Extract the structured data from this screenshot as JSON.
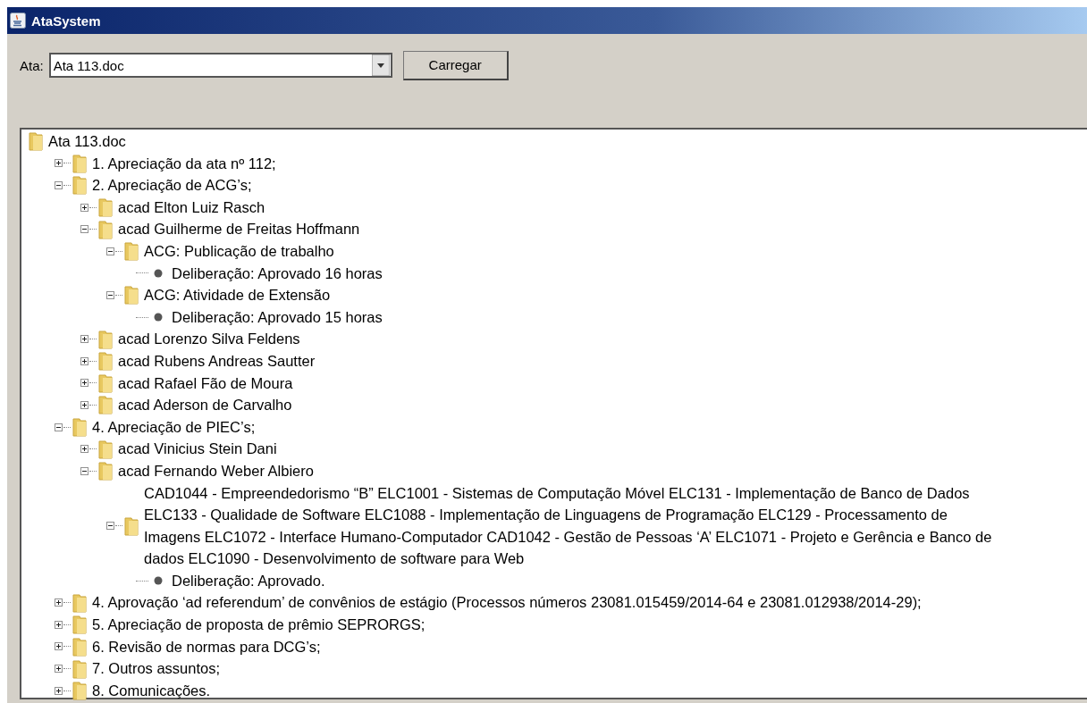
{
  "window": {
    "title": "AtaSystem"
  },
  "toolbar": {
    "label": "Ata:",
    "combo_value": "Ata 113.doc",
    "button": "Carregar"
  },
  "tree": {
    "label": "Ata 113.doc",
    "kind": "folder",
    "children": [
      {
        "label": "1. Apreciação da ata nº 112;",
        "kind": "folder",
        "expanded": false
      },
      {
        "label": "2. Apreciação de ACG’s;",
        "kind": "folder",
        "expanded": true,
        "children": [
          {
            "label": "acad Elton Luiz Rasch",
            "kind": "folder",
            "expanded": false
          },
          {
            "label": "acad Guilherme de Freitas Hoffmann",
            "kind": "folder",
            "expanded": true,
            "children": [
              {
                "label": "ACG: Publicação de trabalho",
                "kind": "folder",
                "expanded": true,
                "children": [
                  {
                    "label": "Deliberação: Aprovado 16 horas",
                    "kind": "leaf"
                  }
                ]
              },
              {
                "label": "ACG: Atividade de Extensão",
                "kind": "folder",
                "expanded": true,
                "children": [
                  {
                    "label": "Deliberação: Aprovado 15 horas",
                    "kind": "leaf"
                  }
                ]
              }
            ]
          },
          {
            "label": "acad Lorenzo Silva Feldens",
            "kind": "folder",
            "expanded": false
          },
          {
            "label": "acad Rubens Andreas Sautter",
            "kind": "folder",
            "expanded": false
          },
          {
            "label": "acad Rafael Fão de Moura",
            "kind": "folder",
            "expanded": false
          },
          {
            "label": "acad Aderson de Carvalho",
            "kind": "folder",
            "expanded": false
          }
        ]
      },
      {
        "label": "4. Apreciação de PIEC’s;",
        "kind": "folder",
        "expanded": true,
        "children": [
          {
            "label": "acad Vinicius Stein Dani",
            "kind": "folder",
            "expanded": false
          },
          {
            "label": "acad Fernando Weber Albiero",
            "kind": "folder",
            "expanded": true,
            "children": [
              {
                "label": "CAD1044 - Empreendedorismo “B” ELC1001 - Sistemas de Computação Móvel ELC131 - Implementação de Banco de Dados ELC133 - Qualidade de Software ELC1088 - Implementação de Linguagens de Programação ELC129 - Processamento de Imagens ELC1072 - Interface Humano-Computador CAD1042 - Gestão de Pessoas ‘A’ ELC1071 - Projeto e Gerência e Banco de dados ELC1090 - Desenvolvimento de software para Web",
                "kind": "folder",
                "expanded": true,
                "children": [
                  {
                    "label": "Deliberação: Aprovado.",
                    "kind": "leaf"
                  }
                ]
              }
            ]
          }
        ]
      },
      {
        "label": "4. Aprovação ‘ad referendum’ de convênios de estágio (Processos números 23081.015459/2014-64 e 23081.012938/2014-29);",
        "kind": "folder",
        "expanded": false
      },
      {
        "label": "5. Apreciação de proposta de prêmio SEPRORGS;",
        "kind": "folder",
        "expanded": false
      },
      {
        "label": "6. Revisão de normas para DCG’s;",
        "kind": "folder",
        "expanded": false
      },
      {
        "label": "7. Outros assuntos;",
        "kind": "folder",
        "expanded": false
      },
      {
        "label": "8. Comunicações.",
        "kind": "folder",
        "expanded": false
      }
    ]
  }
}
